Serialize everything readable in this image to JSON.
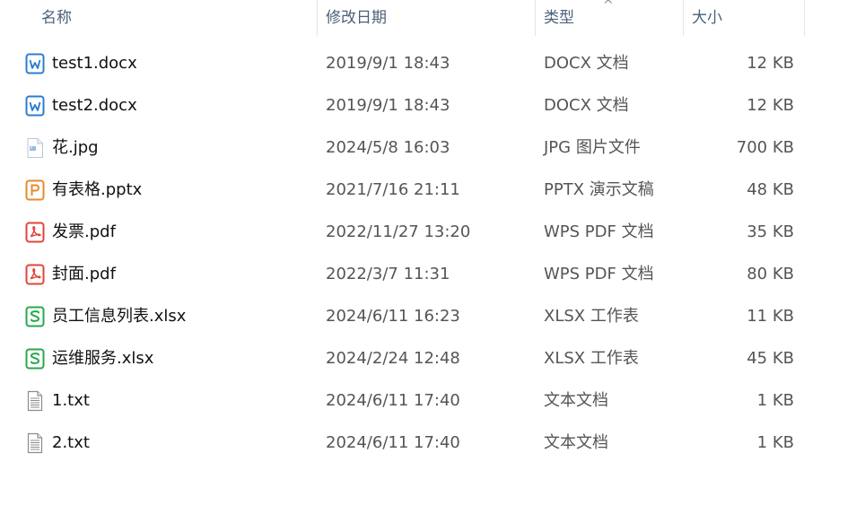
{
  "columns": {
    "name": "名称",
    "date": "修改日期",
    "type": "类型",
    "size": "大小",
    "sort_indicator": "^"
  },
  "files": [
    {
      "name": "test1.docx",
      "date": "2019/9/1 18:43",
      "type": "DOCX 文档",
      "size": "12 KB",
      "icon": "word-doc-icon",
      "color": "#2b7cd3"
    },
    {
      "name": "test2.docx",
      "date": "2019/9/1 18:43",
      "type": "DOCX 文档",
      "size": "12 KB",
      "icon": "word-doc-icon",
      "color": "#2b7cd3"
    },
    {
      "name": "花.jpg",
      "date": "2024/5/8 16:03",
      "type": "JPG 图片文件",
      "size": "700 KB",
      "icon": "image-file-icon",
      "color": "#9bbbe0"
    },
    {
      "name": "有表格.pptx",
      "date": "2021/7/16 21:11",
      "type": "PPTX 演示文稿",
      "size": "48 KB",
      "icon": "presentation-file-icon",
      "color": "#ea8a2a"
    },
    {
      "name": "发票.pdf",
      "date": "2022/11/27 13:20",
      "type": "WPS PDF 文档",
      "size": "35 KB",
      "icon": "pdf-file-icon",
      "color": "#e0463b"
    },
    {
      "name": "封面.pdf",
      "date": "2022/3/7 11:31",
      "type": "WPS PDF 文档",
      "size": "80 KB",
      "icon": "pdf-file-icon",
      "color": "#e0463b"
    },
    {
      "name": "员工信息列表.xlsx",
      "date": "2024/6/11 16:23",
      "type": "XLSX 工作表",
      "size": "11 KB",
      "icon": "spreadsheet-file-icon",
      "color": "#27a84e"
    },
    {
      "name": "运维服务.xlsx",
      "date": "2024/2/24 12:48",
      "type": "XLSX 工作表",
      "size": "45 KB",
      "icon": "spreadsheet-file-icon",
      "color": "#27a84e"
    },
    {
      "name": "1.txt",
      "date": "2024/6/11 17:40",
      "type": "文本文档",
      "size": "1 KB",
      "icon": "text-file-icon",
      "color": "#8c8c8c"
    },
    {
      "name": "2.txt",
      "date": "2024/6/11 17:40",
      "type": "文本文档",
      "size": "1 KB",
      "icon": "text-file-icon",
      "color": "#8c8c8c"
    }
  ]
}
